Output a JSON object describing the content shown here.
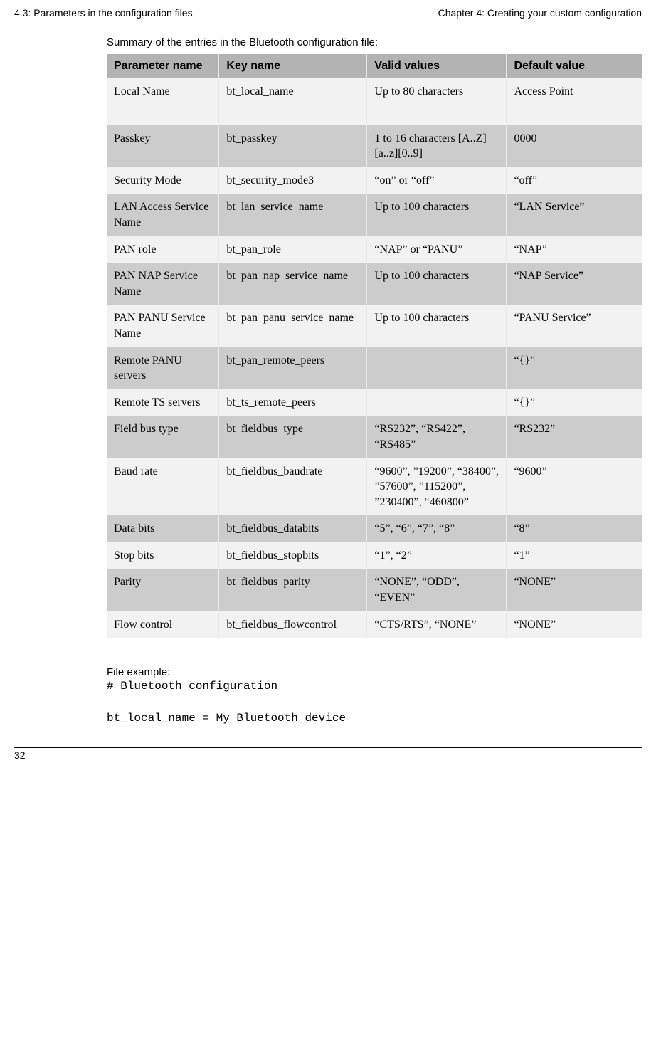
{
  "header": {
    "left": "4.3: Parameters in the configuration files",
    "right": "Chapter 4: Creating your custom configuration"
  },
  "summary_line": "Summary of the entries in the Bluetooth configuration file:",
  "columns": {
    "c1": "Parameter name",
    "c2": "Key name",
    "c3": "Valid values",
    "c4": "Default value"
  },
  "rows": [
    {
      "param": "Local Name",
      "key": "bt_local_name",
      "valid": "Up to 80 characters",
      "default": "Access Point"
    },
    {
      "param": "Passkey",
      "key": "bt_passkey",
      "valid": "1 to 16 characters [A..Z][a..z][0..9]",
      "default": "0000"
    },
    {
      "param": "Security Mode",
      "key": "bt_security_mode3",
      "valid": "“on” or “off”",
      "default": "“off”"
    },
    {
      "param": "LAN Access Service Name",
      "key": "bt_lan_service_name",
      "valid": "Up to 100 charac­ters",
      "default": "“LAN Service”"
    },
    {
      "param": "PAN role",
      "key": "bt_pan_role",
      "valid": "“NAP” or “PANU”",
      "default": "“NAP”"
    },
    {
      "param": "PAN NAP Ser­vice Name",
      "key": "bt_pan_nap_service_​name",
      "valid": "Up to 100 charac­ters",
      "default": "“NAP Service”"
    },
    {
      "param": "PAN PANU Ser­vice Name",
      "key": "bt_pan_panu_service​_name",
      "valid": "Up to 100 charac­ters",
      "default": "“PANU Service”"
    },
    {
      "param": "Remote PANU servers",
      "key": "bt_pan_remote_peers",
      "valid": "",
      "default": "“{}”"
    },
    {
      "param": "Remote TS serv­ers",
      "key": "bt_ts_remote_peers",
      "valid": "",
      "default": "“{}”"
    },
    {
      "param": "Field bus type",
      "key": "bt_fieldbus_type",
      "valid": "“RS232”, “RS422”, “RS485”",
      "default": "“RS232”"
    },
    {
      "param": "Baud rate",
      "key": "bt_fieldbus_baudrate",
      "valid": "“9600”, ”19200”, “38400”, ”57600”, ”115200”, ”230400”, “460800”",
      "default": "“9600”"
    },
    {
      "param": "Data bits",
      "key": "bt_fieldbus_databits",
      "valid": "“5”, “6”, “7”, “8”",
      "default": "“8”"
    },
    {
      "param": "Stop bits",
      "key": "bt_fieldbus_stopbits",
      "valid": "“1”, “2”",
      "default": "“1”"
    },
    {
      "param": "Parity",
      "key": "bt_fieldbus_parity",
      "valid": "“NONE”, “ODD”, “EVEN”",
      "default": "“NONE”"
    },
    {
      "param": "Flow control",
      "key": "bt_fieldbus_flowcont​rol",
      "valid": "“CTS/RTS”, “NONE”",
      "default": "“NONE”"
    }
  ],
  "file_example_label": "File example:",
  "code_lines": [
    "# Bluetooth configuration",
    "",
    "bt_local_name = My Bluetooth device"
  ],
  "page_number": "32"
}
